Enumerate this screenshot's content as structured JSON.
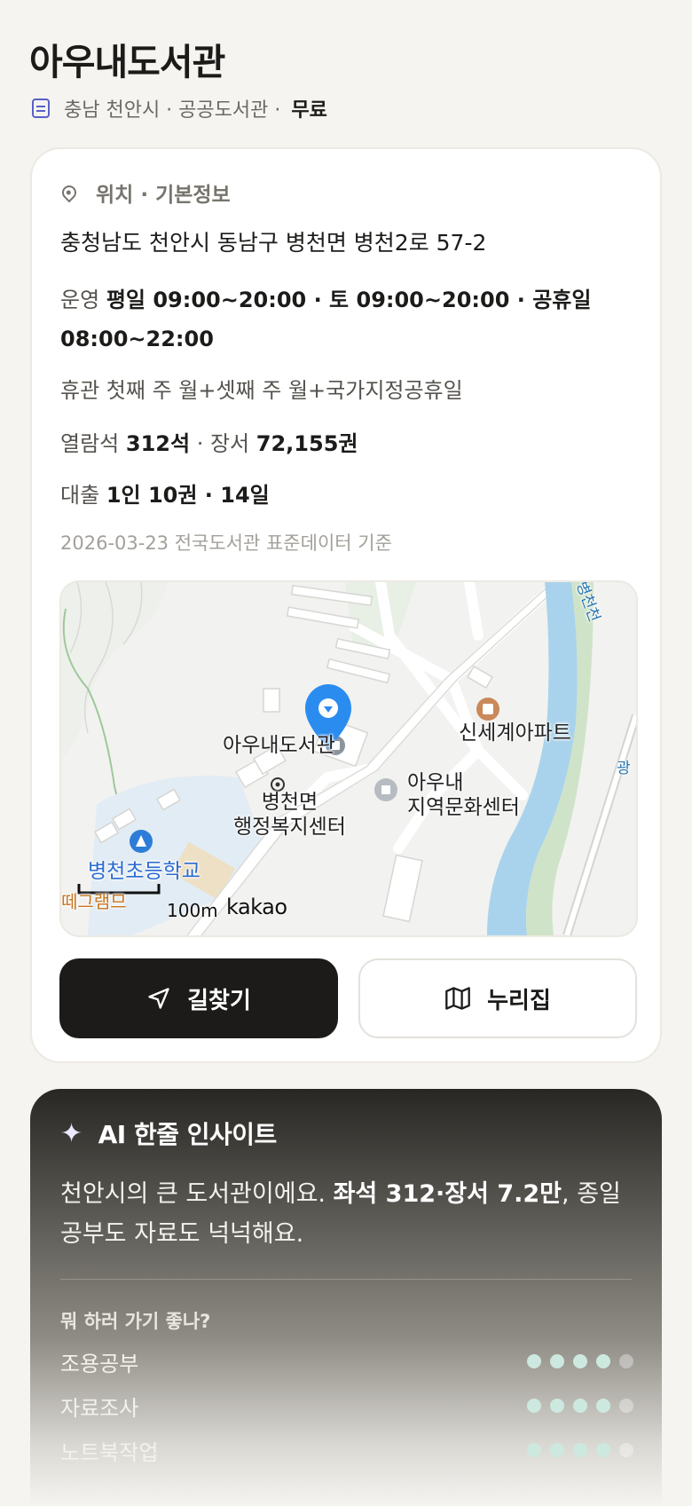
{
  "header": {
    "title": "아우내도서관",
    "meta_text": "충남 천안시 · 공공도서관 ·",
    "fee": "무료"
  },
  "info": {
    "section_label": "위치 · 기본정보",
    "address": "충청남도 천안시 동남구 병천면 병천2로 57-2",
    "hours_label": "운영",
    "hours_value": "평일 09:00~20:00 · 토 09:00~20:00 · 공휴일 08:00~22:00",
    "closed_text": "휴관 첫째 주 월+셋째 주 월+국가지정공휴일",
    "seats_label": "열람석",
    "seats_value": "312석",
    "books_label": "· 장서",
    "books_value": "72,155권",
    "loan_label": "대출",
    "loan_value": "1인 10권 · 14일",
    "source": "2026-03-23 전국도서관 표준데이터 기준"
  },
  "map": {
    "labels": {
      "library": "아우내도서관",
      "apartment": "신세계아파트",
      "culture_center": "아우내\n지역문화센터",
      "office": "병천면\n행정복지센터",
      "school": "병천초등학교",
      "river_top": "병천천",
      "river_right": "광",
      "partial": "떼그램므"
    },
    "scale": "100m",
    "provider": "kakao"
  },
  "actions": {
    "directions": "길찾기",
    "nurijip": "누리집"
  },
  "ai": {
    "title": "AI 한줄 인사이트",
    "text_1": "천안시의 큰 도서관이에요. ",
    "text_bold": "좌석 312·장서 7.2만",
    "text_2": ", 종일 공부도 자료도 넉넉해요.",
    "question": "뭐 하러 가기 좋나?",
    "ratings": [
      {
        "label": "조용공부",
        "score": 4,
        "max": 5
      },
      {
        "label": "자료조사",
        "score": 4,
        "max": 5
      },
      {
        "label": "노트북작업",
        "score": 4,
        "max": 5
      }
    ]
  },
  "colors": {
    "accent_blue": "#2b8cf0",
    "dark": "#1c1b19",
    "rating_on": "#cde9df"
  }
}
